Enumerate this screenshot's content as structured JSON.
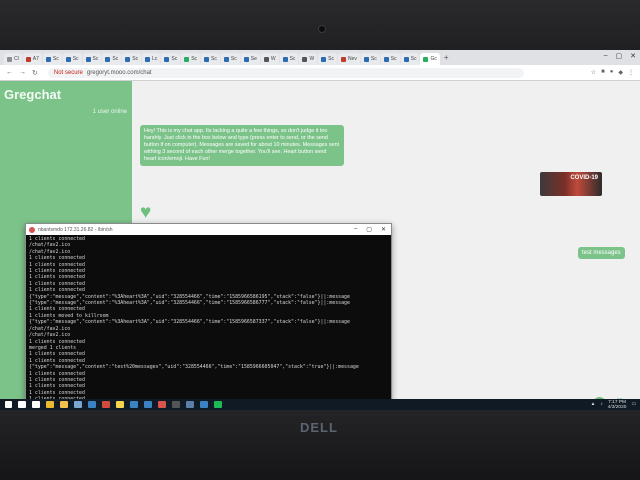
{
  "browser": {
    "tabs": [
      {
        "label": "Cl",
        "color": "#8e8e8e"
      },
      {
        "label": "A7",
        "color": "#c0392b"
      },
      {
        "label": "Sc",
        "color": "#2b6cb0"
      },
      {
        "label": "Sc",
        "color": "#2b6cb0"
      },
      {
        "label": "Sc",
        "color": "#2b6cb0"
      },
      {
        "label": "Sc",
        "color": "#2b6cb0"
      },
      {
        "label": "Sc",
        "color": "#2b6cb0"
      },
      {
        "label": "Lc",
        "color": "#2b6cb0"
      },
      {
        "label": "Sc",
        "color": "#2b6cb0"
      },
      {
        "label": "Sc",
        "color": "#27ae60"
      },
      {
        "label": "Sc",
        "color": "#2b6cb0"
      },
      {
        "label": "Sc",
        "color": "#2b6cb0"
      },
      {
        "label": "Se",
        "color": "#2b6cb0"
      },
      {
        "label": "W",
        "color": "#555555"
      },
      {
        "label": "Sc",
        "color": "#2b6cb0"
      },
      {
        "label": "W",
        "color": "#555555"
      },
      {
        "label": "Sc",
        "color": "#2b6cb0"
      },
      {
        "label": "Nev",
        "color": "#c0392b"
      },
      {
        "label": "Sc",
        "color": "#2b6cb0"
      },
      {
        "label": "Sc",
        "color": "#2b6cb0"
      },
      {
        "label": "Sc",
        "color": "#2b6cb0"
      },
      {
        "label": "Gc",
        "color": "#27ae60"
      }
    ],
    "new_tab": "+",
    "address": {
      "security": "Not secure",
      "url": "gregoryt.mooo.com/chat"
    }
  },
  "chat": {
    "brand": "Gregchat",
    "users_online": "1 user online",
    "intro_message": "Hey! This is my chat app. Its lacking a quite a few things, so don't judge it too harshly. Just click in the box below and type (press enter to send, or the send button if on computer). Messages are saved for about 10 minutes. Messages sent withing 3 second of each other merge together. You'll see. Heart button send heart icon/emoji. Have Fun!",
    "covid_label": "COVID-19",
    "test_message": "test messages",
    "heart_glyph": "♥",
    "send_glyph": "➤"
  },
  "terminal": {
    "title": "nbantsmdo 172.31.26.82 - /bin/sh",
    "lines": [
      "1 clients connected",
      "/chat/fav2.ico",
      "/chat/fav2.ico",
      "1 clients connected",
      "1 clients connected",
      "1 clients connected",
      "1 clients connected",
      "1 clients connected",
      "1 clients connected",
      "{\"type\":\"message\",\"content\":\"%3Aheart%3A\",\"uid\":\"328554466\",\"time\":\"1585966586195\",\"stack\":\"false\"}||:message",
      "{\"type\":\"message\",\"content\":\"%3Aheart%3A\",\"uid\":\"328554466\",\"time\":\"1585966586777\",\"stack\":\"false\"}||:message",
      "1 clients connected",
      "1 clients moved to killroom",
      "{\"type\":\"message\",\"content\":\"%3Aheart%3A\",\"uid\":\"328554466\",\"time\":\"1585966587337\",\"stack\":\"false\"}||:message",
      "/chat/fav2.ico",
      "/chat/fav2.ico",
      "1 clients connected",
      "merged 1 clients",
      "1 clients connected",
      "1 clients connected",
      "{\"type\":\"message\",\"content\":\"test%20messages\",\"uid\":\"328554466\",\"time\":\"1585966605047\",\"stack\":\"true\"}||:message",
      "1 clients connected",
      "1 clients connected",
      "1 clients connected",
      "1 clients connected",
      "1 clients connected",
      "1 clients connected",
      "1 clients connected"
    ]
  },
  "taskbar": {
    "icons": [
      {
        "name": "cortana-search-icon",
        "color": "#ffffff"
      },
      {
        "name": "task-view-icon",
        "color": "#ffffff"
      },
      {
        "name": "chrome-icon",
        "color": "#e8b830"
      },
      {
        "name": "file-explorer-icon",
        "color": "#f2c14e"
      },
      {
        "name": "steam-icon",
        "color": "#7aa6d0"
      },
      {
        "name": "store-icon",
        "color": "#3b82c4"
      },
      {
        "name": "snip-tool-icon",
        "color": "#d04b3b"
      },
      {
        "name": "sticky-notes-icon",
        "color": "#f2d44e"
      },
      {
        "name": "monitor-app-icon",
        "color": "#3b82c4"
      },
      {
        "name": "mail-icon",
        "color": "#3b82c4"
      },
      {
        "name": "chrome-app-icon",
        "color": "#d9534f"
      },
      {
        "name": "terminal-app-icon",
        "color": "#555555"
      },
      {
        "name": "steam-app-icon",
        "color": "#5b7fa6"
      },
      {
        "name": "settings-app-icon",
        "color": "#3b82c4"
      },
      {
        "name": "spotify-icon",
        "color": "#1db954"
      }
    ],
    "clock_time": "7:17 PM",
    "clock_date": "4/3/2020"
  },
  "hardware": {
    "brand": "DELL"
  }
}
